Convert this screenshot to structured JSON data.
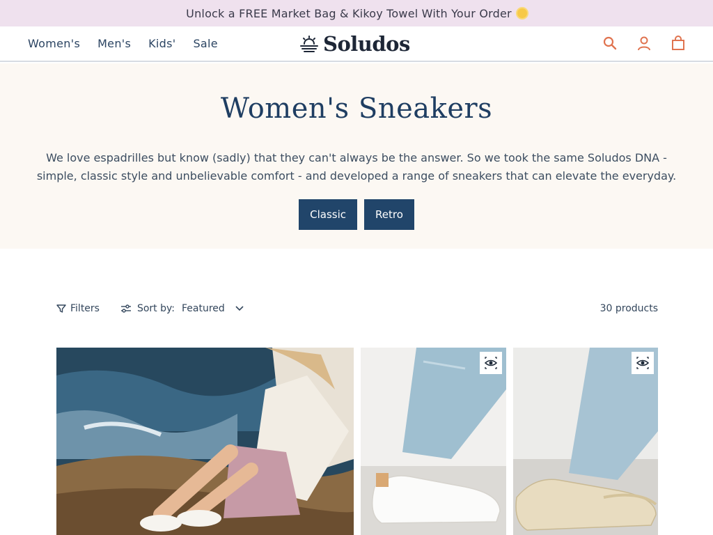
{
  "announcement": {
    "text": "Unlock a FREE Market Bag & Kikoy Towel With Your Order",
    "icon": "sun-icon"
  },
  "nav": {
    "items": [
      "Women's",
      "Men's",
      "Kids'",
      "Sale"
    ]
  },
  "logo": {
    "text": "Soludos",
    "icon": "sun-logo-icon"
  },
  "header_icons": [
    "search-icon",
    "account-icon",
    "cart-icon"
  ],
  "hero": {
    "title": "Women's Sneakers",
    "description": "We love espadrilles but know (sadly) that they can't always be the answer. So we took the same Soludos DNA - simple, classic style and unbelievable comfort - and developed a range of sneakers that can elevate the everyday.",
    "buttons": [
      "Classic",
      "Retro"
    ]
  },
  "toolbar": {
    "filters_label": "Filters",
    "sort_label": "Sort by:",
    "sort_value": "Featured",
    "count": "30 products"
  },
  "colors": {
    "announcement_bg": "#efe1ee",
    "hero_bg": "#fcf8f3",
    "primary_navy": "#21456a",
    "icon_accent": "#e0734f"
  }
}
